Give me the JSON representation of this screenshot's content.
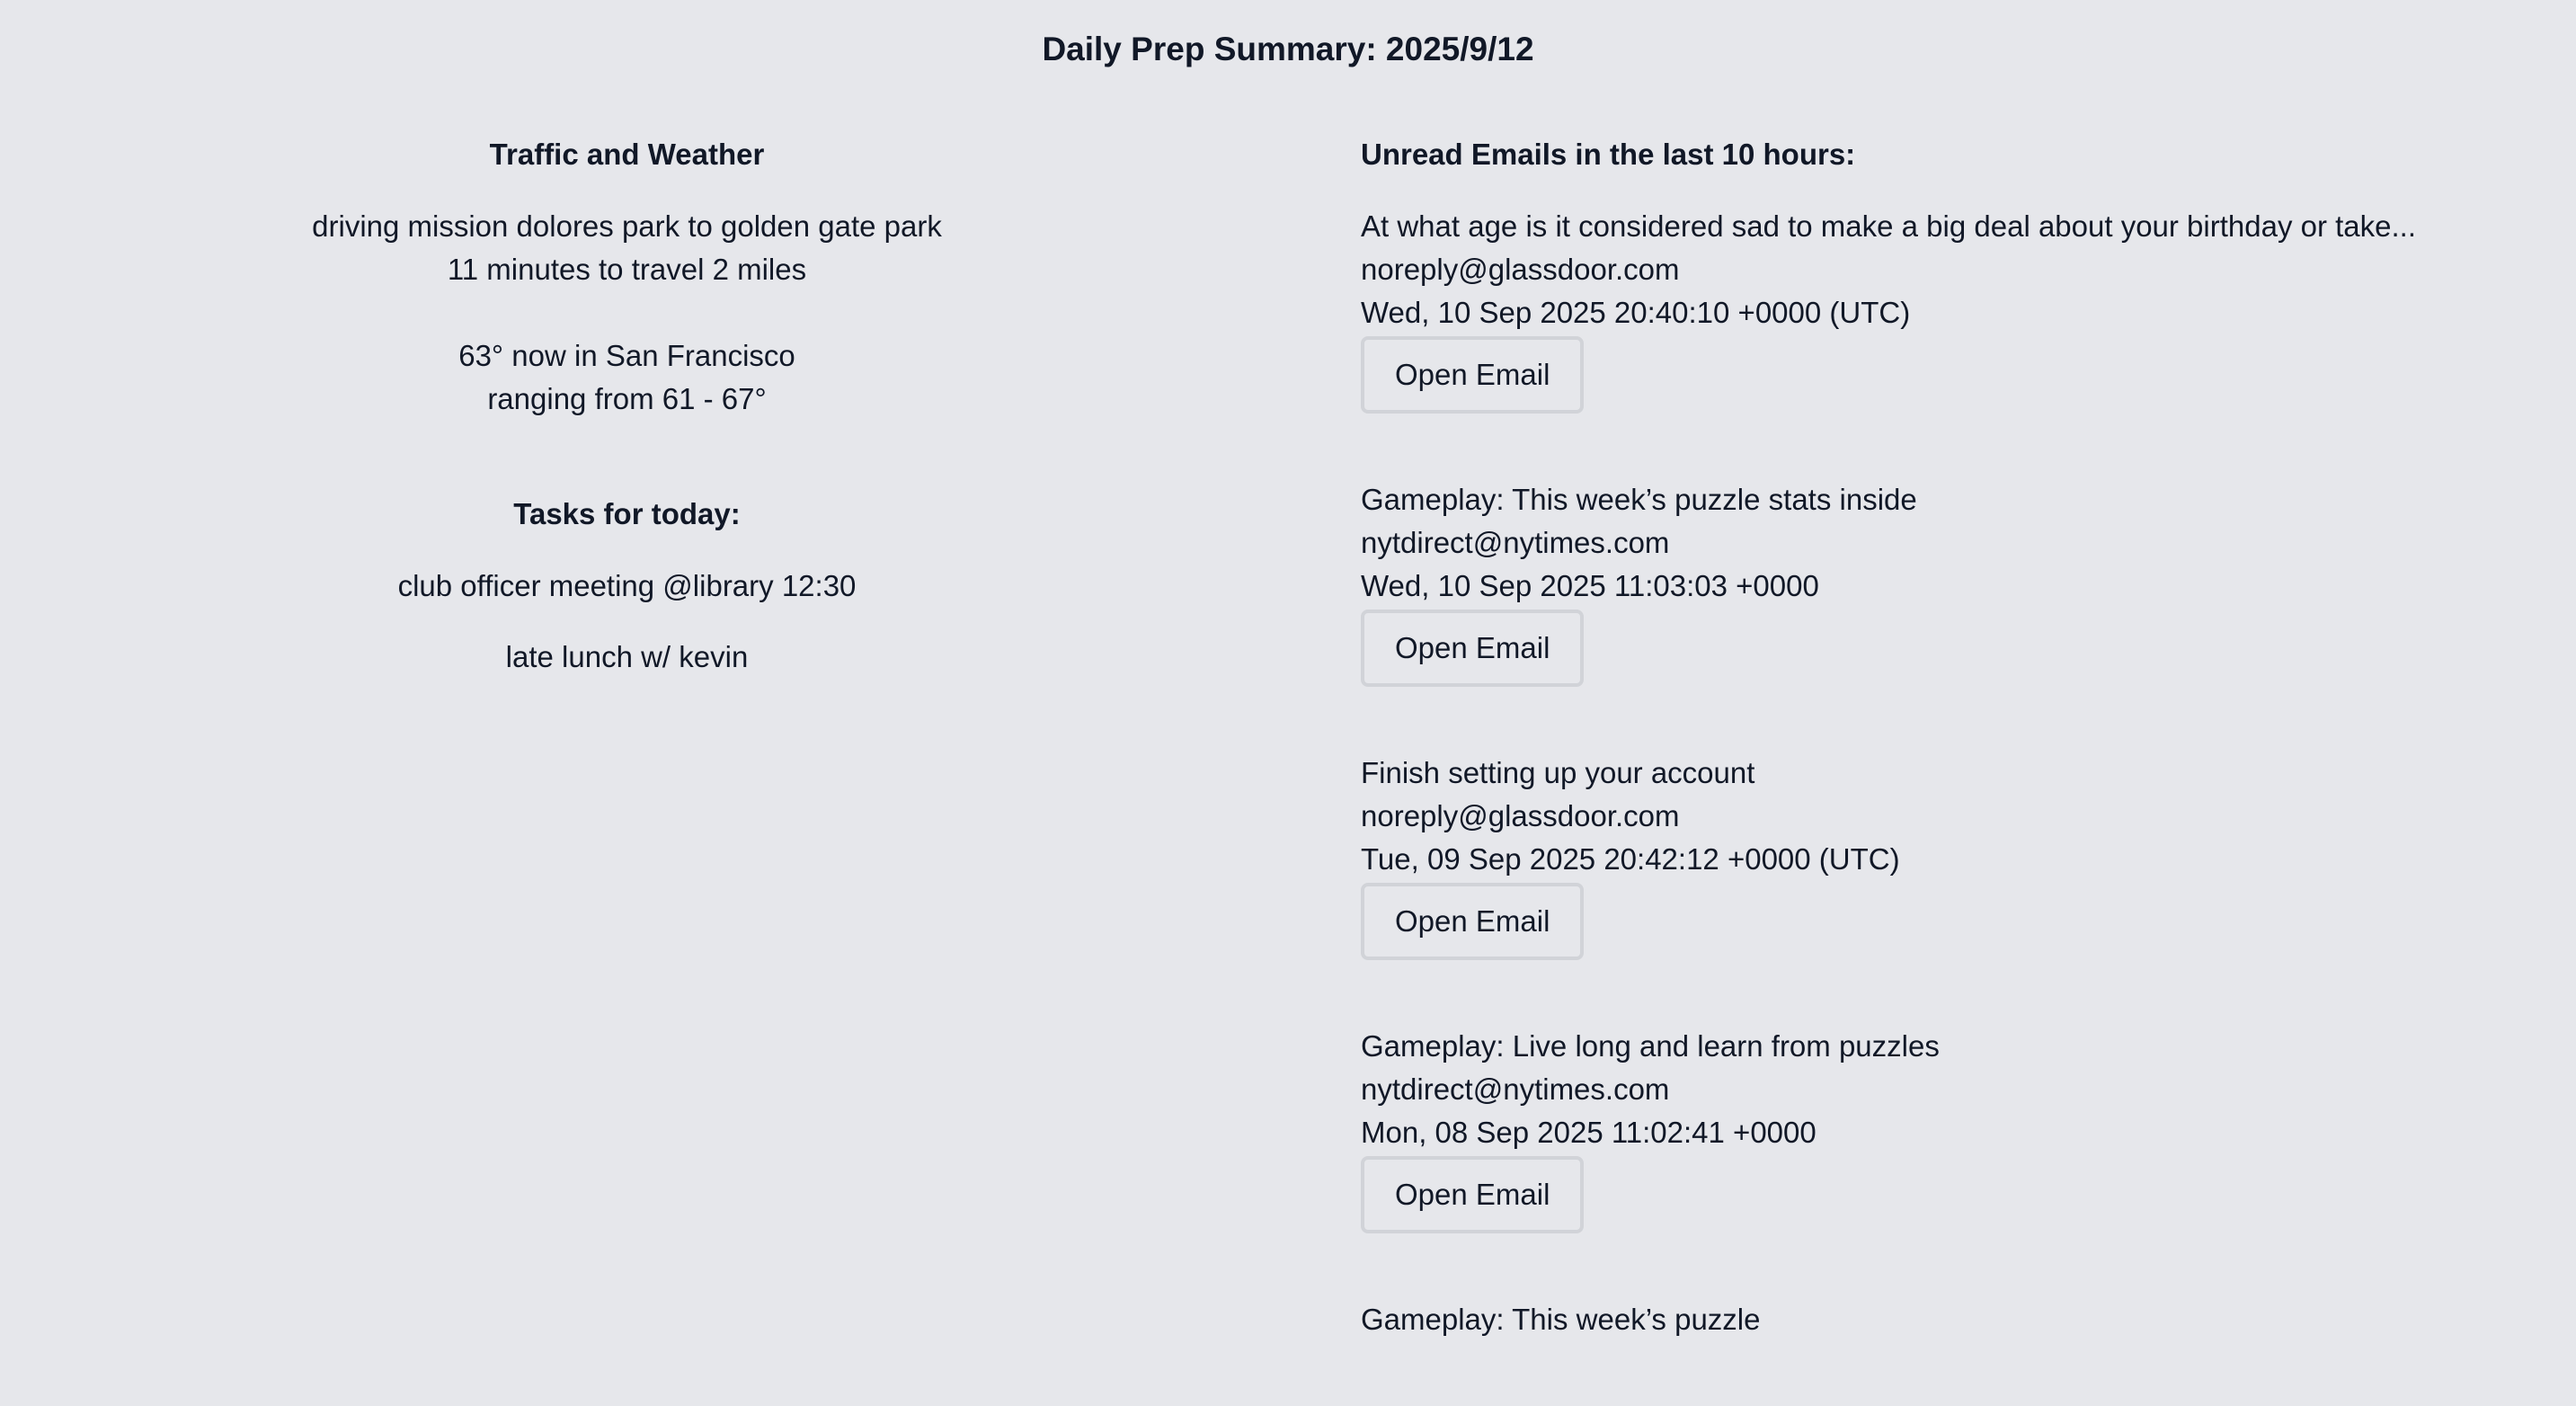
{
  "page": {
    "title": "Daily Prep Summary: 2025/9/12"
  },
  "traffic_weather": {
    "heading": "Traffic and Weather",
    "route": "driving mission dolores park to golden gate park",
    "travel_time": "11 minutes to travel 2 miles",
    "current_temp": "63° now in San Francisco",
    "temp_range": "ranging from 61 - 67°"
  },
  "tasks": {
    "heading": "Tasks for today:",
    "items": [
      "club officer meeting @library 12:30",
      "late lunch w/ kevin"
    ]
  },
  "emails": {
    "heading": "Unread Emails in the last 10 hours:",
    "button_label": "Open Email",
    "items": [
      {
        "subject": "At what age is it considered sad to make a big deal about your birthday or take...",
        "sender": "noreply@glassdoor.com",
        "date": "Wed, 10 Sep 2025 20:40:10 +0000 (UTC)"
      },
      {
        "subject": "Gameplay: This week’s puzzle stats inside",
        "sender": "nytdirect@nytimes.com",
        "date": "Wed, 10 Sep 2025 11:03:03 +0000"
      },
      {
        "subject": "Finish setting up your account",
        "sender": "noreply@glassdoor.com",
        "date": "Tue, 09 Sep 2025 20:42:12 +0000 (UTC)"
      },
      {
        "subject": "Gameplay: Live long and learn from puzzles",
        "sender": "nytdirect@nytimes.com",
        "date": "Mon, 08 Sep 2025 11:02:41 +0000"
      },
      {
        "subject": "Gameplay: This week’s puzzle",
        "sender": "",
        "date": ""
      }
    ]
  }
}
